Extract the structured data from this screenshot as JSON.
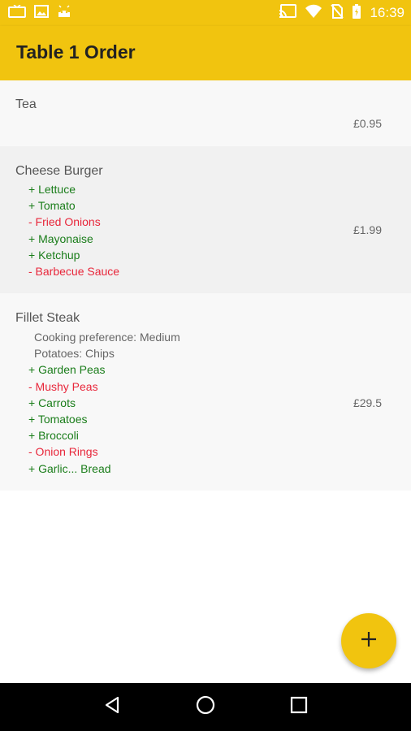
{
  "status_bar": {
    "time": "16:39",
    "icons_left": [
      "tv-icon",
      "image-icon",
      "android-icon"
    ],
    "icons_right": [
      "cast-icon",
      "wifi-icon",
      "no-sim-icon",
      "battery-charging-icon"
    ]
  },
  "app_bar": {
    "title": "Table 1 Order"
  },
  "colors": {
    "accent": "#f1c40f",
    "add": "#1a7d1a",
    "remove": "#e8263a"
  },
  "orders": [
    {
      "name": "Tea",
      "price": "£0.95",
      "modifiers": []
    },
    {
      "name": "Cheese Burger",
      "price": "£1.99",
      "modifiers": [
        {
          "type": "plus",
          "text": "+ Lettuce"
        },
        {
          "type": "plus",
          "text": "+ Tomato"
        },
        {
          "type": "minus",
          "text": "- Fried Onions"
        },
        {
          "type": "plus",
          "text": "+ Mayonaise"
        },
        {
          "type": "plus",
          "text": "+ Ketchup"
        },
        {
          "type": "minus",
          "text": "- Barbecue Sauce"
        }
      ]
    },
    {
      "name": "Fillet Steak",
      "price": "£29.5",
      "modifiers": [
        {
          "type": "info",
          "text": "Cooking preference: Medium"
        },
        {
          "type": "info",
          "text": "Potatoes: Chips"
        },
        {
          "type": "plus",
          "text": "+ Garden Peas"
        },
        {
          "type": "minus",
          "text": "- Mushy Peas"
        },
        {
          "type": "plus",
          "text": "+ Carrots"
        },
        {
          "type": "plus",
          "text": "+ Tomatoes"
        },
        {
          "type": "plus",
          "text": "+ Broccoli"
        },
        {
          "type": "minus",
          "text": "- Onion Rings"
        },
        {
          "type": "plus",
          "text": "+ Garlic... Bread"
        }
      ]
    }
  ],
  "fab": {
    "icon": "plus-icon"
  },
  "nav_bar": {
    "buttons": [
      "back-icon",
      "home-icon",
      "recents-icon"
    ]
  }
}
